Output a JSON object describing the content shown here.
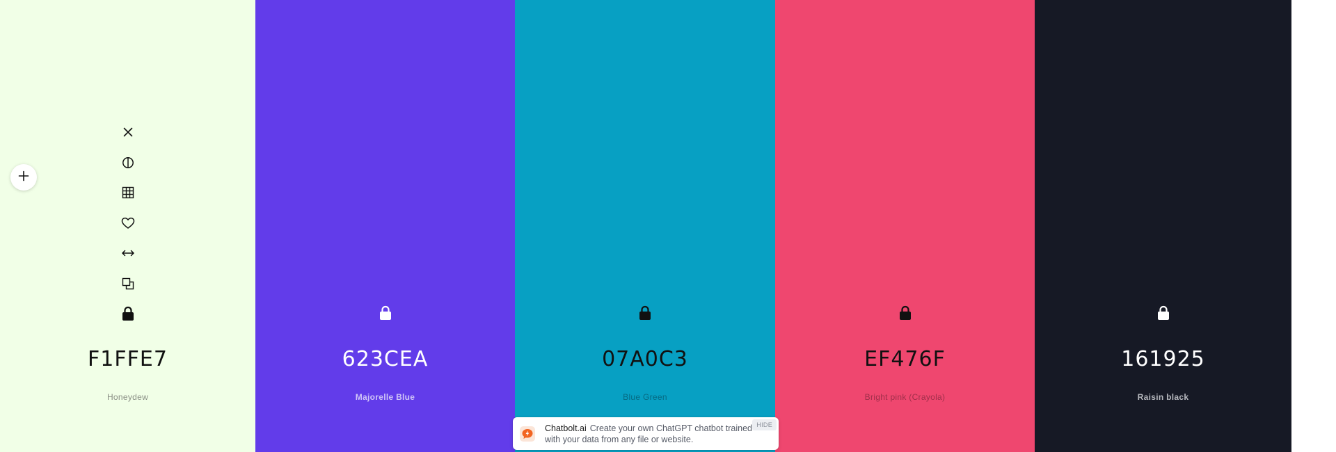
{
  "tools": {
    "remove": "close-icon",
    "shades": "contrast-icon",
    "grid": "grid-icon",
    "favorite": "heart-icon",
    "drag": "arrows-horizontal-icon",
    "copy": "copy-icon",
    "lock": "lock-icon"
  },
  "add_button": {
    "icon": "plus-icon"
  },
  "swatches": [
    {
      "hex": "F1FFE7",
      "name": "Honeydew",
      "color": "#F1FFE7",
      "text_color": "#111111",
      "name_color": "#8a8f85",
      "tools_visible": true
    },
    {
      "hex": "623CEA",
      "name": "Majorelle Blue",
      "color": "#623CEA",
      "text_color": "#ffffff",
      "name_color": "#cfc4f7",
      "tools_visible": false
    },
    {
      "hex": "07A0C3",
      "name": "Blue Green",
      "color": "#07A0C3",
      "text_color": "#111111",
      "name_color": "#066a82",
      "tools_visible": false
    },
    {
      "hex": "EF476F",
      "name": "Bright pink (Crayola)",
      "color": "#EF476F",
      "text_color": "#111111",
      "name_color": "#9e2f4a",
      "tools_visible": false
    },
    {
      "hex": "161925",
      "name": "Raisin black",
      "color": "#161925",
      "text_color": "#ffffff",
      "name_color": "#b5b7bd",
      "tools_visible": false
    }
  ],
  "ad": {
    "brand": "Chatbolt.ai",
    "text": "Create your own ChatGPT chatbot trained with your data from any file or website.",
    "hide_label": "HIDE",
    "logo_icon": "chat-bolt-logo-icon",
    "logo_color": "#F26522"
  }
}
